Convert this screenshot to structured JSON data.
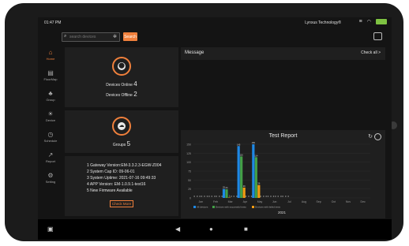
{
  "status": {
    "time": "01:47 PM",
    "brand": "Lynxus Technology®"
  },
  "search": {
    "placeholder": "search devices",
    "button": "Search"
  },
  "sidebar": {
    "items": [
      {
        "label": "Home",
        "icon": "home-icon",
        "glyph": "⌂",
        "active": true
      },
      {
        "label": "FloorMap",
        "icon": "floormap-icon",
        "glyph": "▤"
      },
      {
        "label": "Group",
        "icon": "group-icon",
        "glyph": "♣"
      },
      {
        "label": "Device",
        "icon": "bulb-icon",
        "glyph": "☀"
      },
      {
        "label": "Schedule",
        "icon": "clock-icon",
        "glyph": "◷"
      },
      {
        "label": "Report",
        "icon": "chart-icon",
        "glyph": "↗"
      },
      {
        "label": "Setting",
        "icon": "gear-icon",
        "glyph": "⚙"
      }
    ]
  },
  "devices": {
    "online_label": "Devices Online",
    "online_count": "4",
    "offline_label": "Devices Offline",
    "offline_count": "2"
  },
  "groups": {
    "label": "Groups",
    "count": "5"
  },
  "info": {
    "lines": [
      "1 Gateway Version:EM-3.3.2.3-EGW-Z004",
      "2 System Cap ID: 09-06-01",
      "3 System Uptime: 2021-07-16 09:49:33",
      "4 APP Version: EM-1.0.9.1-test16",
      "5 New Firmware Available"
    ],
    "check_button": "Check More"
  },
  "message": {
    "title": "Message",
    "link": "Check all >"
  },
  "colors": {
    "accent": "#f0803c",
    "series": [
      "#1e88e5",
      "#43a047",
      "#f39c12"
    ]
  },
  "chart_data": {
    "type": "bar",
    "title": "Test Report",
    "xlabel": "2021",
    "categories": [
      "Jan",
      "Feb",
      "Mar",
      "Apr",
      "May",
      "Jun",
      "Jul",
      "Aug",
      "Sep",
      "Oct",
      "Nov",
      "Dec"
    ],
    "ylim": [
      0,
      150
    ],
    "yticks": [
      0,
      25,
      50,
      75,
      100,
      125,
      150
    ],
    "series": [
      {
        "name": "All devices",
        "values": [
          0,
          0,
          0,
          0,
          25,
          0,
          145,
          0,
          150,
          0,
          0,
          0,
          0
        ]
      },
      {
        "name": "Devices with successful tests",
        "values": [
          0,
          0,
          0,
          0,
          24,
          0,
          116,
          0,
          114,
          0,
          0,
          0,
          0
        ]
      },
      {
        "name": "Devices with failed tests",
        "values": [
          0,
          0,
          0,
          0,
          1,
          0,
          29,
          0,
          36,
          0,
          0,
          0,
          0
        ]
      }
    ]
  }
}
